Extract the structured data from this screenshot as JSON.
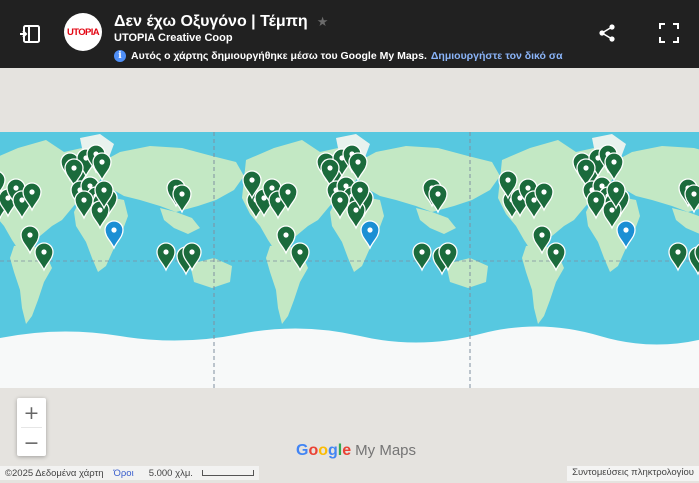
{
  "header": {
    "logo_text": "UTOPIA",
    "title": "Δεν έχω Οξυγόνο | Τέμπη",
    "author": "UTOPIA Creative Coop",
    "notice": "Αυτός ο χάρτης δημιουργήθηκε μέσω του Google My Maps.",
    "notice_link": "Δημιουργήστε τον δικό σα",
    "star_glyph": "★",
    "info_glyph": "i"
  },
  "map": {
    "map_type": "world map, repeated horizontally",
    "colors": {
      "ocean": "#57c8e0",
      "land": "#c3e8c4",
      "ice": "#f7f9f9",
      "marker_primary": "#1b6b3c",
      "marker_secondary": "#1b8fd4",
      "header_bg": "#212121",
      "link": "#8ab4f8"
    },
    "marker_counts": {
      "green_per_world_copy": 27,
      "blue_per_world_copy": 1
    }
  },
  "controls": {
    "zoom_in": "+",
    "zoom_out": "−"
  },
  "branding": {
    "google": [
      "G",
      "o",
      "o",
      "g",
      "l",
      "e"
    ],
    "google_colors": [
      "#4285F4",
      "#EA4335",
      "#FBBC05",
      "#4285F4",
      "#34A853",
      "#EA4335"
    ],
    "product": "My Maps"
  },
  "footer": {
    "copyright": "©2025 Δεδομένα χάρτη",
    "terms": "Όροι",
    "scale": "5.000 χλμ.",
    "shortcuts": "Συντομεύσεις πληκτρολογίου"
  }
}
